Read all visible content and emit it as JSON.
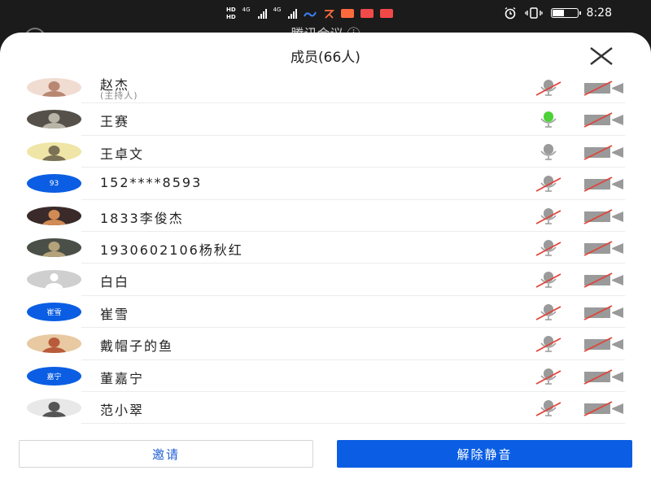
{
  "status_bar": {
    "hd1": "HD",
    "hd2": "HD",
    "net1": "4G",
    "net2": "4G",
    "time": "8:28",
    "battery_level": 0.45,
    "app_colors": [
      "#3b82f6",
      "#ff6a3d",
      "#f04a4a",
      "#f24848"
    ]
  },
  "background": {
    "title": "腾讯会议 ⓘ"
  },
  "sheet": {
    "title": "成员(66人)",
    "close_icon": "close-icon"
  },
  "colors": {
    "accent": "#0b5ee3",
    "mic_active": "#4cd137",
    "muted_slash": "#e0443a",
    "icon_gray": "#9a9a9a"
  },
  "members": [
    {
      "name": "赵杰",
      "sub": "(主持人)",
      "avatar": {
        "kind": "photo",
        "bg": "#f1dcd2",
        "fg": "#b88772"
      },
      "mic": "muted",
      "camera": "off"
    },
    {
      "name": "王赛",
      "avatar": {
        "kind": "photo",
        "bg": "#55504a",
        "fg": "#b9b4a8"
      },
      "mic": "speaking",
      "camera": "off"
    },
    {
      "name": "王卓文",
      "avatar": {
        "kind": "photo",
        "bg": "#efe5a6",
        "fg": "#7b7156"
      },
      "mic": "on",
      "camera": "off"
    },
    {
      "name": "152****8593",
      "avatar": {
        "kind": "text",
        "text": "93",
        "bg": "#0b5ee3"
      },
      "mic": "muted",
      "camera": "off"
    },
    {
      "name": "1833李俊杰",
      "avatar": {
        "kind": "photo",
        "bg": "#3a2a2a",
        "fg": "#d18b55"
      },
      "mic": "muted",
      "camera": "off"
    },
    {
      "name": "1930602106杨秋红",
      "avatar": {
        "kind": "photo",
        "bg": "#4a4f47",
        "fg": "#b4a27a"
      },
      "mic": "muted",
      "camera": "off"
    },
    {
      "name": "白白",
      "avatar": {
        "kind": "default",
        "bg": "#cfcfcf"
      },
      "mic": "muted",
      "camera": "off"
    },
    {
      "name": "崔雪",
      "avatar": {
        "kind": "text",
        "text": "崔雪",
        "bg": "#0b5ee3"
      },
      "mic": "muted",
      "camera": "off"
    },
    {
      "name": "戴帽子的鱼",
      "avatar": {
        "kind": "photo",
        "bg": "#e8c9a2",
        "fg": "#b85b3b"
      },
      "mic": "muted",
      "camera": "off"
    },
    {
      "name": "董嘉宁",
      "avatar": {
        "kind": "text",
        "text": "嘉宁",
        "bg": "#0b5ee3"
      },
      "mic": "muted",
      "camera": "off"
    },
    {
      "name": "范小翠",
      "avatar": {
        "kind": "photo",
        "bg": "#e8e8e8",
        "fg": "#555"
      },
      "mic": "muted",
      "camera": "off"
    }
  ],
  "actions": {
    "invite": "邀请",
    "unmute": "解除静音"
  }
}
